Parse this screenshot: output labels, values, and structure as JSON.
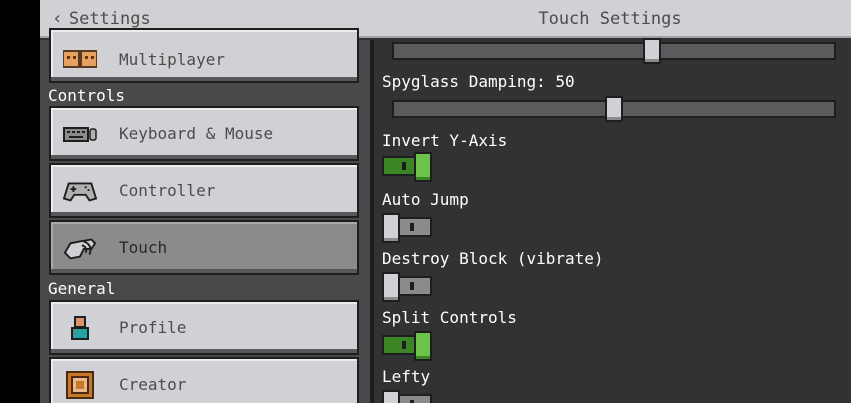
{
  "header": {
    "back_label": "Settings",
    "title": "Touch Settings"
  },
  "sidebar": {
    "items": [
      {
        "label": "Multiplayer",
        "icon": "multiplayer-icon"
      },
      {
        "label": "Keyboard & Mouse",
        "icon": "keyboard-icon"
      },
      {
        "label": "Controller",
        "icon": "controller-icon"
      },
      {
        "label": "Touch",
        "icon": "touch-icon",
        "active": true
      },
      {
        "label": "Profile",
        "icon": "profile-icon"
      },
      {
        "label": "Creator",
        "icon": "creator-icon"
      }
    ],
    "sections": {
      "controls": "Controls",
      "general": "General"
    }
  },
  "settings": {
    "top_slider": {
      "value_fraction": 0.59
    },
    "spyglass": {
      "label": "Spyglass Damping: 50",
      "value": 50
    },
    "invert_y": {
      "label": "Invert Y-Axis",
      "state": "on"
    },
    "auto_jump": {
      "label": "Auto Jump",
      "state": "off"
    },
    "destroy_block": {
      "label": "Destroy Block (vibrate)",
      "state": "off"
    },
    "split_controls": {
      "label": "Split Controls",
      "state": "on"
    },
    "lefty": {
      "label": "Lefty",
      "state": "off"
    }
  },
  "colors": {
    "toggle_on": "#3c8527",
    "panel": "#313233",
    "sidebar_bg": "#48494a",
    "button": "#d0d1d4"
  }
}
